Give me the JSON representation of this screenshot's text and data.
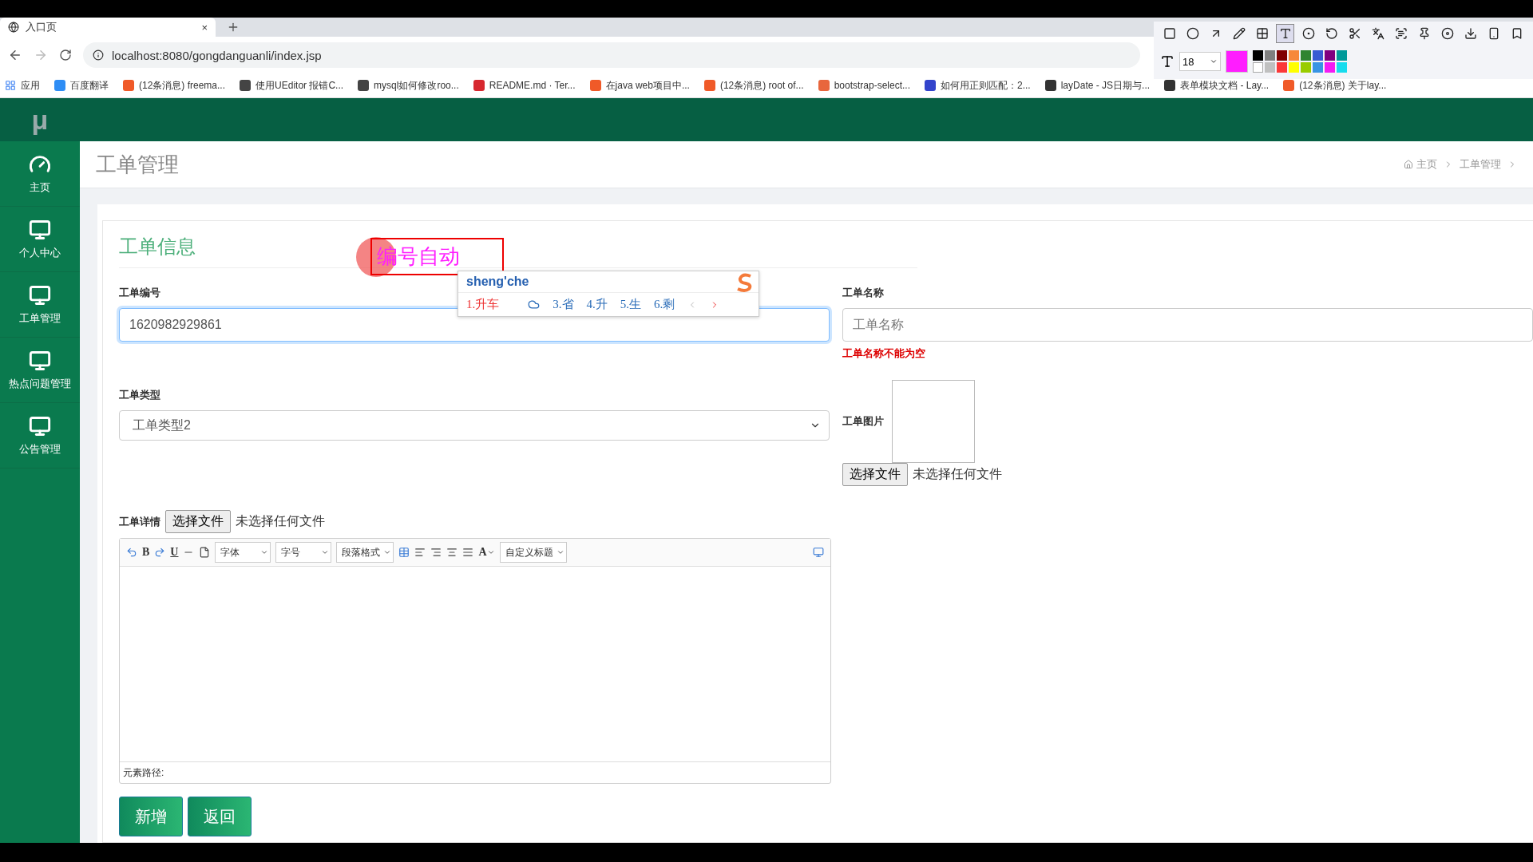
{
  "browser": {
    "tab": {
      "title": "入口页",
      "close": "×"
    },
    "url": "localhost:8080/gongdanguanli/index.jsp",
    "bookmarks": [
      {
        "label": "应用",
        "kind": "apps"
      },
      {
        "label": "百度翻译",
        "color": "#2e8df5"
      },
      {
        "label": "(12条消息) freema...",
        "color": "#f05a28"
      },
      {
        "label": "使用UEditor 报错C...",
        "color": "#444444"
      },
      {
        "label": "mysql如何修改roo...",
        "color": "#444444"
      },
      {
        "label": "README.md · Ter...",
        "color": "#d7282f"
      },
      {
        "label": "在java web项目中...",
        "color": "#f05a28"
      },
      {
        "label": "(12条消息) root of...",
        "color": "#f05a28"
      },
      {
        "label": "bootstrap-select...",
        "color": "#e8663d"
      },
      {
        "label": "如何用正则匹配：2...",
        "color": "#3344cc"
      },
      {
        "label": "layDate - JS日期与...",
        "color": "#333333"
      },
      {
        "label": "表单模块文档 - Lay...",
        "color": "#333333"
      },
      {
        "label": "(12条消息) 关于lay...",
        "color": "#f05a28"
      }
    ]
  },
  "capture_toolbar": {
    "tools": [
      {
        "kind": "rect",
        "selected": false
      },
      {
        "kind": "ellipse",
        "selected": false
      },
      {
        "kind": "arrow",
        "selected": false
      },
      {
        "kind": "pen",
        "selected": false
      },
      {
        "kind": "mosaic",
        "selected": false
      },
      {
        "kind": "text",
        "selected": true
      },
      {
        "kind": "number",
        "selected": false
      },
      {
        "kind": "undo",
        "selected": false
      },
      {
        "kind": "cut",
        "selected": false
      },
      {
        "kind": "translate",
        "selected": false
      },
      {
        "kind": "ocr",
        "selected": false
      },
      {
        "kind": "pin",
        "selected": false
      },
      {
        "kind": "record",
        "selected": false
      },
      {
        "kind": "download",
        "selected": false
      },
      {
        "kind": "phone",
        "selected": false
      },
      {
        "kind": "bookmark",
        "selected": false
      }
    ],
    "font_size": "18",
    "palette": [
      {
        "color": "#000000"
      },
      {
        "color": "#808080"
      },
      {
        "color": "#800000"
      },
      {
        "color": "#f7883a"
      },
      {
        "color": "#308430"
      },
      {
        "color": "#385ad3"
      },
      {
        "color": "#800080"
      },
      {
        "color": "#009999"
      },
      {
        "color": "#ffffff"
      },
      {
        "color": "#c0c0c0"
      },
      {
        "color": "#fb3838"
      },
      {
        "color": "#ffff00"
      },
      {
        "color": "#99cc00"
      },
      {
        "color": "#3894e4"
      },
      {
        "color": "#f31bf3"
      },
      {
        "color": "#16dcee"
      }
    ]
  },
  "app": {
    "logo": "μ",
    "sidebar": [
      {
        "label": "主页",
        "kind": "dashboard"
      },
      {
        "label": "个人中心",
        "kind": "monitor"
      },
      {
        "label": "工单管理",
        "kind": "monitor"
      },
      {
        "label": "热点问题管理",
        "kind": "monitor"
      },
      {
        "label": "公告管理",
        "kind": "monitor"
      }
    ],
    "page_title": "工单管理",
    "breadcrumb": [
      "主页",
      "工单管理"
    ],
    "form": {
      "heading": "工单信息",
      "number": {
        "label": "工单编号",
        "value": "1620982929861"
      },
      "name": {
        "label": "工单名称",
        "placeholder": "工单名称",
        "error": "工单名称不能为空"
      },
      "type": {
        "label": "工单类型",
        "value": "工单类型2"
      },
      "picture": {
        "label": "工单图片",
        "button": "选择文件",
        "status": "未选择任何文件"
      },
      "detail": {
        "label": "工单详情",
        "button": "选择文件",
        "status": "未选择任何文件"
      },
      "editor": {
        "toolbar": [
          {
            "kind": "undo"
          },
          {
            "kind": "letter",
            "text": "B"
          },
          {
            "kind": "redo"
          },
          {
            "kind": "underline",
            "text": "U"
          },
          {
            "kind": "rule"
          },
          {
            "kind": "page"
          },
          {
            "kind": "select",
            "text": "字体"
          },
          {
            "kind": "select",
            "text": "字号"
          },
          {
            "kind": "select",
            "text": "段落格式"
          },
          {
            "kind": "table"
          },
          {
            "kind": "align-left"
          },
          {
            "kind": "align-right"
          },
          {
            "kind": "align-center"
          },
          {
            "kind": "align-justify"
          },
          {
            "kind": "color",
            "text": "A"
          },
          {
            "kind": "select",
            "text": "自定义标题"
          },
          {
            "kind": "fullscreen"
          }
        ],
        "path_label": "元素路径:"
      },
      "buttons": [
        "新增",
        "返回"
      ]
    }
  },
  "ime": {
    "input": "sheng'che",
    "candidates": [
      {
        "text": "1.升车",
        "selected": true
      },
      {
        "kind": "cloud",
        "selected": false
      },
      {
        "text": "3.省",
        "selected": false
      },
      {
        "text": "4.升",
        "selected": false
      },
      {
        "text": "5.生",
        "selected": false
      },
      {
        "text": "6.剩",
        "selected": false
      }
    ]
  },
  "annotation": {
    "text": "编号自动"
  }
}
